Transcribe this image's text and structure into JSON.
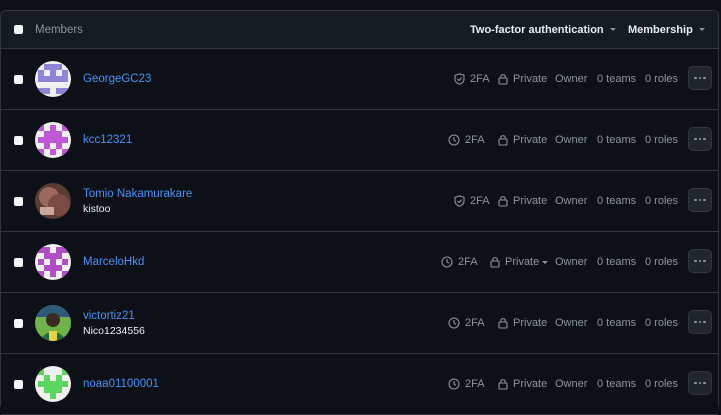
{
  "header": {
    "title": "Members",
    "filter_2fa": "Two-factor authentication",
    "filter_membership": "Membership"
  },
  "members": [
    {
      "login": "GeorgeGC23",
      "fullname": "",
      "twofa_icon": "shield-check-icon",
      "twofa": "2FA",
      "visibility": "Private",
      "visibility_dropdown": false,
      "role": "Owner",
      "teams": "0 teams",
      "roles": "0 roles",
      "avatar": "identicon-purple-blue"
    },
    {
      "login": "kcc12321",
      "fullname": "",
      "twofa_icon": "clock-icon",
      "twofa": "2FA",
      "visibility": "Private",
      "visibility_dropdown": false,
      "role": "Owner",
      "teams": "0 teams",
      "roles": "0 roles",
      "avatar": "identicon-magenta"
    },
    {
      "login": "Tomio Nakamurakare",
      "fullname": "kistoo",
      "twofa_icon": "shield-check-icon",
      "twofa": "2FA",
      "visibility": "Private",
      "visibility_dropdown": false,
      "role": "Owner",
      "teams": "0 teams",
      "roles": "0 roles",
      "avatar": "photo-avatar"
    },
    {
      "login": "MarceloHkd",
      "fullname": "",
      "twofa_icon": "clock-icon",
      "twofa": "2FA",
      "visibility": "Private",
      "visibility_dropdown": true,
      "role": "Owner",
      "teams": "0 teams",
      "roles": "0 roles",
      "avatar": "identicon-violet"
    },
    {
      "login": "victortiz21",
      "fullname": "Nico1234556",
      "twofa_icon": "clock-icon",
      "twofa": "2FA",
      "visibility": "Private",
      "visibility_dropdown": false,
      "role": "Owner",
      "teams": "0 teams",
      "roles": "0 roles",
      "avatar": "photo-avatar-green"
    },
    {
      "login": "noaa01100001",
      "fullname": "",
      "twofa_icon": "clock-icon",
      "twofa": "2FA",
      "visibility": "Private",
      "visibility_dropdown": false,
      "role": "Owner",
      "teams": "0 teams",
      "roles": "0 roles",
      "avatar": "identicon-green"
    }
  ],
  "colors": {
    "link": "#4493f8",
    "muted": "#8b949e",
    "border": "#30363d",
    "background": "#0d1117"
  }
}
